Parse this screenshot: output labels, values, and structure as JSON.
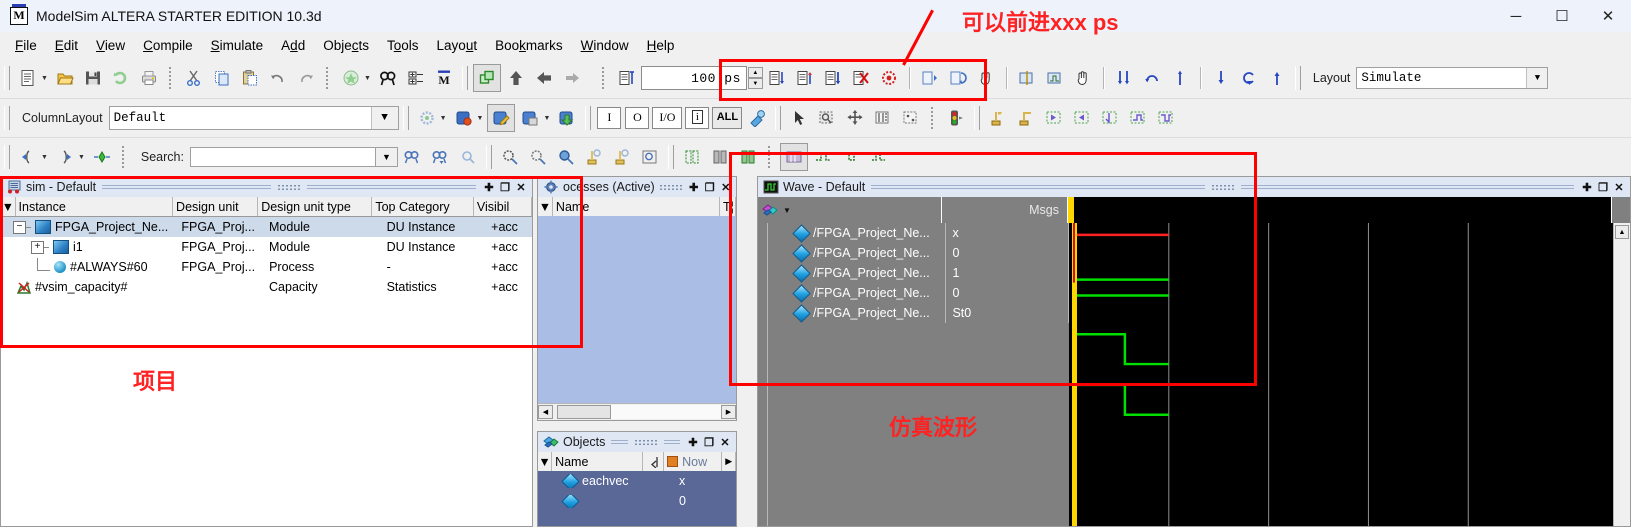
{
  "window": {
    "title": "ModelSim ALTERA STARTER EDITION 10.3d",
    "app_icon": "modelsim-m-icon",
    "minimize": "─",
    "maximize": "☐",
    "close": "✕"
  },
  "menubar": {
    "items": [
      {
        "label": "File",
        "mnemonic": "F"
      },
      {
        "label": "Edit",
        "mnemonic": "E"
      },
      {
        "label": "View",
        "mnemonic": "V"
      },
      {
        "label": "Compile",
        "mnemonic": "C"
      },
      {
        "label": "Simulate",
        "mnemonic": "S"
      },
      {
        "label": "Add",
        "mnemonic": "d"
      },
      {
        "label": "Objects",
        "mnemonic": "c"
      },
      {
        "label": "Tools",
        "mnemonic": "o"
      },
      {
        "label": "Layout",
        "mnemonic": "u"
      },
      {
        "label": "Bookmarks",
        "mnemonic": "k"
      },
      {
        "label": "Window",
        "mnemonic": "W"
      },
      {
        "label": "Help",
        "mnemonic": "H"
      }
    ]
  },
  "toolbar_row1": {
    "icons": [
      "new-file-icon",
      "open-folder-icon",
      "save-icon",
      "reload-icon",
      "print-icon",
      "cut-icon",
      "copy-icon",
      "paste-icon",
      "undo-icon",
      "redo-icon",
      "compile-icon",
      "find-icon",
      "expand-all-icon",
      "modelsim-m-icon",
      "column-layout-icon",
      "go-up-icon",
      "go-back-icon",
      "go-forward-icon"
    ],
    "run_icon": "run-icon",
    "sim_time_value": "100 ps",
    "sim_time_placeholder": "100 ps",
    "run_icons": [
      "run-length-icon",
      "continue-run-icon",
      "run-all-icon",
      "break-icon",
      "restart-icon"
    ],
    "step_icons": [
      "step-icon",
      "step-over-icon",
      "hand-icon"
    ],
    "wave_icons": [
      "insert-cursor-icon",
      "expand-wave-icon",
      "collapse-wave-icon"
    ],
    "layout_label": "Layout",
    "layout_value": "Simulate"
  },
  "toolbar_row2": {
    "column_layout_label": "ColumnLayout",
    "column_layout_value": "Default",
    "memory_icons": [
      "memory-icon",
      "breakpoint-icon",
      "edit-breakpoint-icon",
      "save-breakpoint-icon",
      "load-breakpoint-icon"
    ],
    "filter_buttons": [
      "I",
      "O",
      "I/O",
      "i",
      "ALL"
    ],
    "filter_extra_icon": "filter-icon",
    "select_icons": [
      "select-arrow-icon",
      "zoom-select-icon",
      "pan-icon",
      "measure-icon",
      "grid-icon",
      "traffic-light-icon"
    ],
    "dataflow_icons": [
      "expand-net-icon",
      "expand-net-down-icon",
      "trace-back-icon",
      "trace-forward-icon",
      "trace-next-icon",
      "trace-event-icon",
      "trace-x-icon"
    ]
  },
  "toolbar_row3": {
    "nav_icons": [
      "prev-signal-icon",
      "next-signal-icon",
      "center-signal-icon"
    ],
    "search_label": "Search:",
    "search_value": "",
    "search_placeholder": "",
    "search_icons": [
      "find-prev-icon",
      "find-next-icon",
      "find-options-icon"
    ],
    "zoom_icons": [
      "zoom-in-icon",
      "zoom-out-icon",
      "zoom-full-icon",
      "zoom-cursor-icon",
      "zoom-range-icon",
      "zoom-last-icon"
    ],
    "wave_format_icons": [
      "wave-format-1-icon",
      "wave-format-2-icon",
      "wave-format-3-icon"
    ],
    "wave_edit_icons": [
      "wave-edit-cut-icon",
      "wave-edit-invert-icon",
      "wave-edit-insert-icon",
      "wave-edit-stretch-icon"
    ]
  },
  "sim_panel": {
    "title": "sim - Default",
    "icon": "sim-panel-icon",
    "buttons": [
      "✚",
      "❐",
      "✕"
    ],
    "columns": [
      "Instance",
      "Design unit",
      "Design unit type",
      "Top Category",
      "Visibil"
    ],
    "rows": [
      {
        "instance": "FPGA_Project_Ne...",
        "design_unit": "FPGA_Proj...",
        "design_unit_type": "Module",
        "top_category": "DU Instance",
        "visibility": "+acc",
        "icon": "module-icon",
        "tree": "minus",
        "indent": 0,
        "selected": true
      },
      {
        "instance": "i1",
        "design_unit": "FPGA_Proj...",
        "design_unit_type": "Module",
        "top_category": "DU Instance",
        "visibility": "+acc",
        "icon": "module-icon",
        "tree": "plus",
        "indent": 1,
        "selected": false
      },
      {
        "instance": "#ALWAYS#60",
        "design_unit": "FPGA_Proj...",
        "design_unit_type": "Process",
        "top_category": "-",
        "visibility": "+acc",
        "icon": "process-icon",
        "tree": "leaf",
        "indent": 2,
        "selected": false
      },
      {
        "instance": "#vsim_capacity#",
        "design_unit": "",
        "design_unit_type": "Capacity",
        "top_category": "Statistics",
        "visibility": "+acc",
        "icon": "statistics-icon",
        "tree": "none",
        "indent": 0,
        "selected": false
      }
    ]
  },
  "processes_panel": {
    "title": "ocesses (Active)",
    "icon": "processes-gear-icon",
    "buttons": [
      "✚",
      "❐",
      "✕"
    ],
    "columns": [
      "Name",
      "T¦"
    ]
  },
  "objects_panel": {
    "title": "Objects",
    "icon": "objects-icon",
    "buttons": [
      "✚",
      "❐",
      "✕"
    ],
    "columns": [
      "Name",
      "Now"
    ],
    "rows": [
      {
        "name": "eachvec",
        "value": "x"
      },
      {
        "name": "",
        "value": "0"
      }
    ]
  },
  "wave_panel": {
    "title": "Wave - Default",
    "icon": "wave-panel-icon",
    "buttons": [
      "✚",
      "❐",
      "✕"
    ],
    "msgs_header": "Msgs",
    "selector_icon": "wave-selector-icon",
    "rows": [
      {
        "name": "/FPGA_Project_Ne...",
        "value": "x",
        "color": "#ff2222",
        "shape": "const-high"
      },
      {
        "name": "/FPGA_Project_Ne...",
        "value": "0",
        "color": "#00e000",
        "shape": "const-low"
      },
      {
        "name": "/FPGA_Project_Ne...",
        "value": "1",
        "color": "#00e000",
        "shape": "const-high"
      },
      {
        "name": "/FPGA_Project_Ne...",
        "value": "0",
        "color": "#00e000",
        "shape": "fall"
      },
      {
        "name": "/FPGA_Project_Ne...",
        "value": "St0",
        "color": "#00e000",
        "shape": "fall"
      }
    ],
    "cursor_color": "#ffd700",
    "background": "#000000"
  },
  "annotations": [
    {
      "id": "annotation-advance-ps",
      "text": "可以前进xxx ps",
      "color": "#f22"
    },
    {
      "id": "annotation-project",
      "text": "项目",
      "color": "#f22"
    },
    {
      "id": "annotation-waveform",
      "text": "仿真波形",
      "color": "#f22"
    }
  ],
  "colors": {
    "accent": "#f00000",
    "title_bg": "#eef2fa",
    "pane_title_bg": "#dfe7f5",
    "selection": "#cddaea",
    "wave_bg": "#000000",
    "wave_panel_gray": "#808080"
  }
}
